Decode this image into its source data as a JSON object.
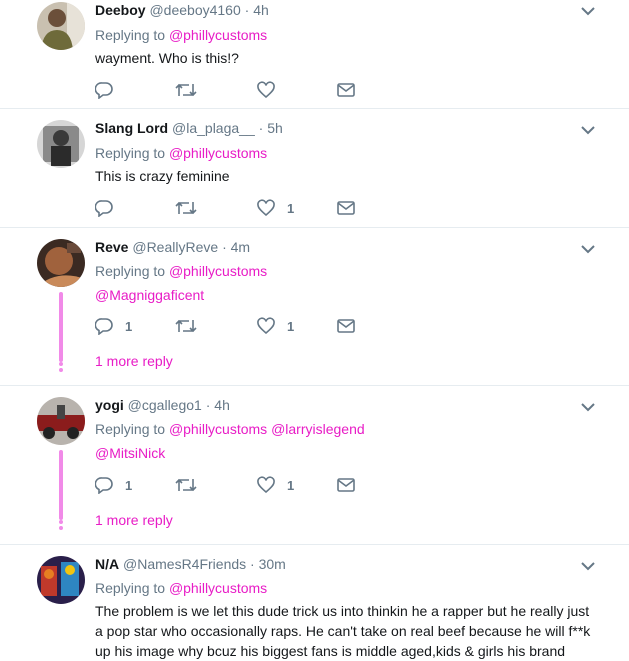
{
  "colors": {
    "accent": "#e81cc6",
    "secondary": "#657786",
    "text": "#14171a",
    "thread": "#f18ae8"
  },
  "icons": {
    "reply": "reply-icon",
    "retweet": "retweet-icon",
    "like": "heart-icon",
    "dm": "envelope-icon",
    "menu": "chevron-down-icon"
  },
  "tweets": [
    {
      "name": "Deeboy",
      "handle": "@deeboy4160",
      "sep": "·",
      "time": "4h",
      "replying_label": "Replying to",
      "mentions": [
        "@phillycustoms"
      ],
      "text": "wayment. Who is this!?",
      "text_mention": "",
      "reply_count": "",
      "like_count": ""
    },
    {
      "name": "Slang Lord",
      "handle": "@la_plaga__",
      "sep": "·",
      "time": "5h",
      "replying_label": "Replying to",
      "mentions": [
        "@phillycustoms"
      ],
      "text": "This is crazy feminine",
      "text_mention": "",
      "reply_count": "",
      "like_count": "1"
    },
    {
      "name": "Reve",
      "handle": "@ReallyReve",
      "sep": "·",
      "time": "4m",
      "replying_label": "Replying to",
      "mentions": [
        "@phillycustoms"
      ],
      "text": "",
      "text_mention": "@Magniggaficent",
      "reply_count": "1",
      "like_count": "1",
      "more_replies": "1 more reply"
    },
    {
      "name": "yogi",
      "handle": "@cgallego1",
      "sep": "·",
      "time": "4h",
      "replying_label": "Replying to",
      "mentions": [
        "@phillycustoms",
        "@larryislegend"
      ],
      "text": "",
      "text_mention": "@MitsiNick",
      "reply_count": "1",
      "like_count": "1",
      "more_replies": "1 more reply"
    },
    {
      "name": "N/A",
      "handle": "@NamesR4Friends",
      "sep": "·",
      "time": "30m",
      "replying_label": "Replying to",
      "mentions": [
        "@phillycustoms"
      ],
      "text_lines": [
        "The problem is we let this dude trick us into thinkin he a rapper but he really just",
        "a pop star who occasionally raps. He can't take on real beef because he will f**k",
        "up his image why bcuz his biggest fans is middle aged,kids & girls his brand"
      ]
    }
  ]
}
